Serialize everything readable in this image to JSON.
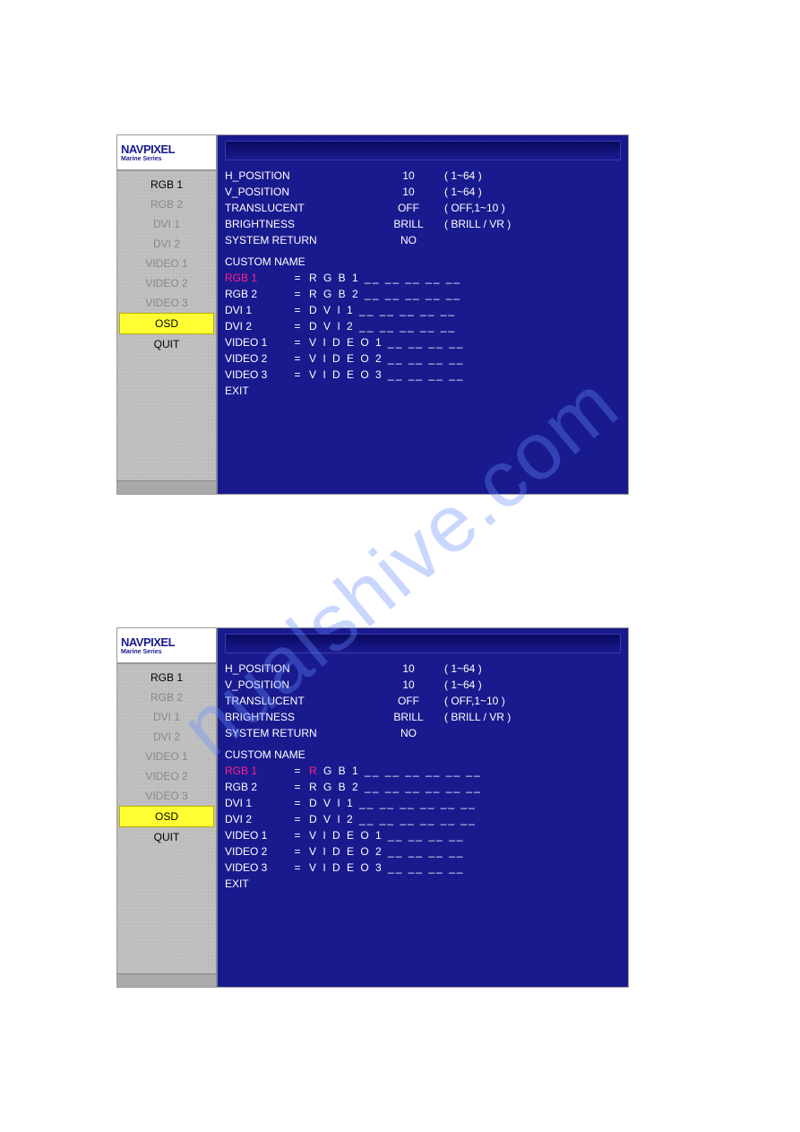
{
  "watermark": "nualshive.com",
  "brand": {
    "name": "NAVPIXEL",
    "series": "Marine Series"
  },
  "menu": {
    "items": [
      {
        "label": "RGB 1",
        "active": true
      },
      {
        "label": "RGB 2"
      },
      {
        "label": "DVI 1"
      },
      {
        "label": "DVI 2"
      },
      {
        "label": "VIDEO 1"
      },
      {
        "label": "VIDEO 2"
      },
      {
        "label": "VIDEO 3"
      },
      {
        "label": "OSD",
        "selected": true
      },
      {
        "label": "QUIT",
        "active": true
      }
    ]
  },
  "settings1": [
    {
      "name": "H_POSITION",
      "value": "10",
      "range": "( 1~64 )"
    },
    {
      "name": "V_POSITION",
      "value": "10",
      "range": "( 1~64 )"
    },
    {
      "name": "TRANSLUCENT",
      "value": "OFF",
      "range": "( OFF,1~10 )"
    },
    {
      "name": "BRIGHTNESS",
      "value": "BRILL",
      "range": "( BRILL / VR )"
    },
    {
      "name": "SYSTEM RETURN",
      "value": "NO",
      "range": ""
    }
  ],
  "settings2": [
    {
      "name": "H_POSITION",
      "value": "10",
      "range": "( 1~64 )"
    },
    {
      "name": "V_POSITION",
      "value": "10",
      "range": "( 1~64 )"
    },
    {
      "name": "TRANSLUCENT",
      "value": "OFF",
      "range": "( OFF,1~10 )"
    },
    {
      "name": "BRIGHTNESS",
      "value": "BRILL",
      "range": "( BRILL / VR )"
    },
    {
      "name": "SYSTEM RETURN",
      "value": "NO",
      "range": ""
    }
  ],
  "custom_title": "CUSTOM NAME",
  "custom1": [
    {
      "label": "RGB 1",
      "value": "R G B 1 __ __ __ __ __",
      "hl": true
    },
    {
      "label": "RGB 2",
      "value": "R G B 2 __ __ __ __ __"
    },
    {
      "label": "DVI 1",
      "value": "D V I 1 __ __ __ __ __"
    },
    {
      "label": "DVI 2",
      "value": "D V I 2 __ __ __ __ __"
    },
    {
      "label": "VIDEO 1",
      "value": "V I D E O 1 __ __ __ __"
    },
    {
      "label": "VIDEO 2",
      "value": "V I D E O 2 __ __ __ __"
    },
    {
      "label": "VIDEO 3",
      "value": "V I D E O 3 __ __ __ __"
    }
  ],
  "custom2": [
    {
      "label": "RGB 1",
      "value_pre": "R",
      "value_post": " G B 1 __ __ __ __ __ __",
      "hl": true,
      "hl_char": true
    },
    {
      "label": "RGB 2",
      "value": "R G B 2 __ __ __ __ __ __"
    },
    {
      "label": "DVI 1",
      "value": "D V I 1 __ __ __ __ __ __"
    },
    {
      "label": "DVI 2",
      "value": "D V I 2 __ __ __ __ __ __"
    },
    {
      "label": "VIDEO 1",
      "value": "V I D E O 1 __ __ __ __"
    },
    {
      "label": "VIDEO 2",
      "value": "V I D E O 2 __ __ __ __"
    },
    {
      "label": "VIDEO 3",
      "value": "V I D E O 3 __ __ __ __"
    }
  ],
  "exit_label": "EXIT"
}
